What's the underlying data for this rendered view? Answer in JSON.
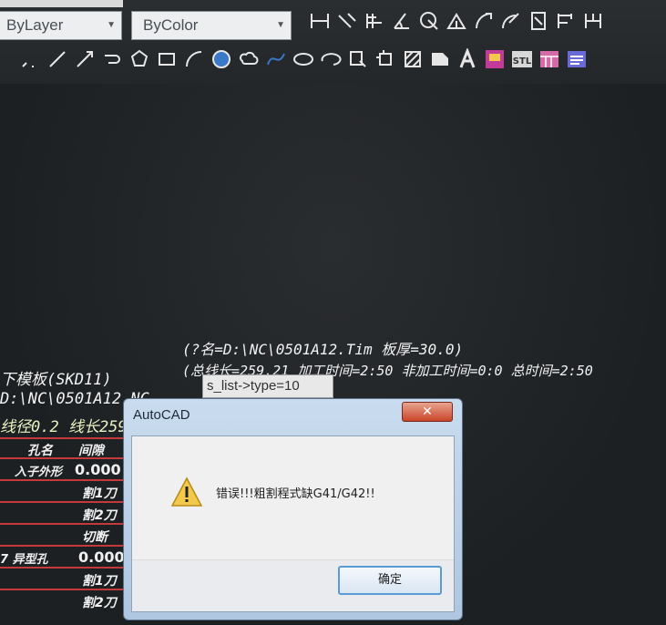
{
  "toolbar": {
    "layer_value": "ByLayer",
    "color_value": "ByColor",
    "row1_icons": [
      "dim-linear-icon",
      "dim-aligned-icon",
      "dim-baseline-icon",
      "dim-angular-icon",
      "dim-radius-icon",
      "dim-angle-icon",
      "dim-arc-icon",
      "dim-arc2-icon",
      "leader-icon",
      "dim-continue-icon",
      "dim-edit-icon"
    ],
    "row2_icons": [
      "point-icon",
      "line-icon",
      "construction-line-icon",
      "polyline-icon",
      "polygon-icon",
      "rectangle-icon",
      "arc-icon",
      "circle-icon",
      "revcloud-icon",
      "spline-icon",
      "ellipse-icon",
      "ellipse-arc-icon",
      "insert-block-icon",
      "make-block-icon",
      "hatch-icon",
      "region-icon",
      "text-icon",
      "mtext-icon",
      "stl-icon",
      "table-icon",
      "multiline-icon"
    ]
  },
  "drawing": {
    "header_line1": "(?名=D:\\NC\\0501A12.Tim   板厚=30.0)",
    "header_line2": "(总线长=259.21   加工时间=2:50   非加工时间=0:0  总时间=2:50",
    "left_title": "下模板(SKD11)",
    "left_path": "D:\\NC\\0501A12.NC",
    "left_partial": "线径0.2  线长259",
    "tooltip": "s_list->type=10",
    "table": {
      "rows": [
        {
          "a": "孔名",
          "b": "间隙"
        },
        {
          "a": "入子外形",
          "b": "0.000"
        },
        {
          "a": "",
          "b": "割1刀"
        },
        {
          "a": "",
          "b": "割2刀"
        },
        {
          "a": "",
          "b": "切断"
        },
        {
          "a": "7  异型孔",
          "b": "0.000"
        },
        {
          "a": "",
          "b": "割1刀"
        },
        {
          "a": "",
          "b": "割2刀"
        }
      ]
    }
  },
  "dialog": {
    "title": "AutoCAD",
    "close_label": "✕",
    "message": "错误!!!粗割程式缺G41/G42!!",
    "ok_label": "确定"
  },
  "colors": {
    "background": "#1f2224",
    "icon_fg": "#e6e6e6",
    "table_line": "#c43a3a",
    "ok_border": "#5a9bd6"
  }
}
